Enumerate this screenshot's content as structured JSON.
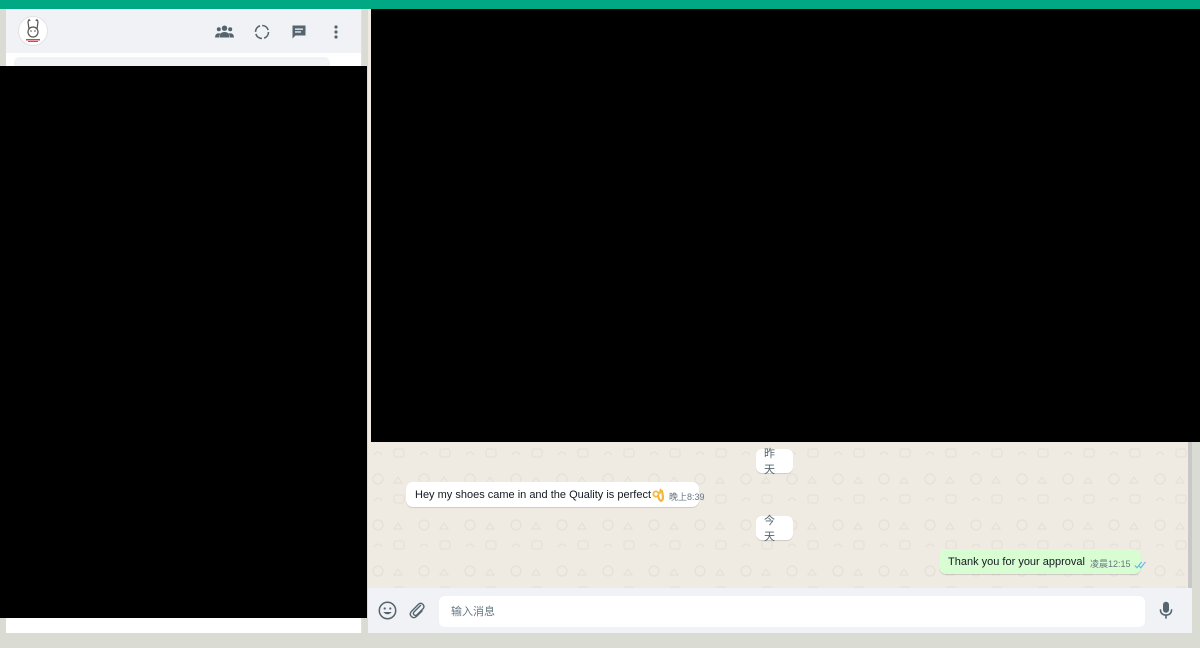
{
  "colors": {
    "accent": "#00a884",
    "panel_bg": "#f0f2f5",
    "chat_bg": "#efeae2",
    "incoming_bubble": "#ffffff",
    "outgoing_bubble": "#d9fdd3",
    "read_tick": "#53bdeb",
    "redaction": "#000000"
  },
  "sidebar": {
    "header_icons": [
      "community-icon",
      "status-icon",
      "new-chat-icon",
      "menu-icon"
    ]
  },
  "chat": {
    "messages": [
      {
        "type": "date",
        "label": "昨天"
      },
      {
        "type": "incoming",
        "text": "Hey my shoes came in and the Quality is perfect",
        "emoji": "ok-hand-emoji",
        "time": "晚上8:39"
      },
      {
        "type": "date",
        "label": "今天"
      },
      {
        "type": "outgoing",
        "text": "Thank you for your approval",
        "time": "凌晨12:15",
        "status": "read"
      }
    ],
    "composer": {
      "placeholder": "输入消息",
      "icons": [
        "emoji-icon",
        "attach-icon",
        "mic-icon"
      ]
    }
  }
}
